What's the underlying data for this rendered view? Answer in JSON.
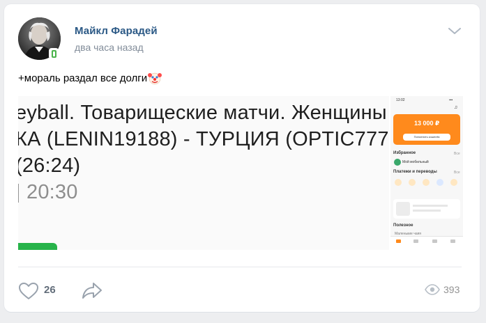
{
  "post": {
    "author": "Майкл Фарадей",
    "time": "два часа назад",
    "text": "+мораль раздал все долги",
    "emoji": "clown-face-icon"
  },
  "media": {
    "screenshot_lines": [
      "eyball. Товарищеские матчи. Женщины",
      "КА (LENIN19188) - ТУРЦИЯ (OPTIC777",
      "(26:24)",
      "| 20:30"
    ],
    "phone": {
      "status_time": "13:02",
      "balance": "13 000 ₽",
      "topup_button": "Пополнить кошелёк",
      "favorites_title": "Избранное",
      "favorites_all": "Все",
      "favorite_item": "Мой мобильный",
      "payments_title": "Платежи и переводы",
      "payments_all": "Все",
      "useful_title": "Полезное",
      "useful_item": "Маленькие чаяя"
    }
  },
  "footer": {
    "likes": "26",
    "views": "393"
  },
  "colors": {
    "author": "#2a5885",
    "accent_orange": "#ff8a1c",
    "online_green": "#4bb34b"
  }
}
